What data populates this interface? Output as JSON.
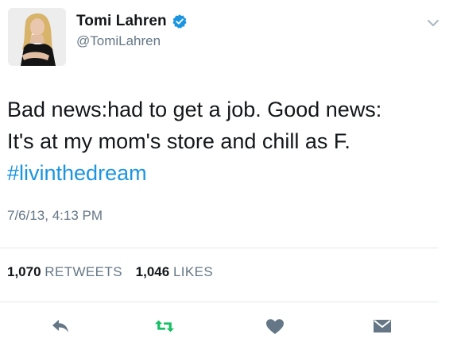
{
  "author": {
    "display_name": "Tomi Lahren",
    "handle": "@TomiLahren",
    "avatar_icon": "profile-photo",
    "verified_icon": "verified-badge-icon"
  },
  "tweet": {
    "line1": "Bad news:had to get a job. Good news:",
    "line2": "It's at my mom's store and chill as F.",
    "hashtag": "#livinthedream",
    "timestamp": "7/6/13, 4:13 PM"
  },
  "stats": {
    "retweets_count": "1,070",
    "retweets_label": "RETWEETS",
    "likes_count": "1,046",
    "likes_label": "LIKES"
  },
  "actions": {
    "reply_icon": "reply-icon",
    "retweet_icon": "retweet-icon",
    "like_icon": "heart-icon",
    "dm_icon": "envelope-icon"
  },
  "colors": {
    "link": "#1b95e0",
    "retweet_green": "#17bf63",
    "icon_gray": "#657786",
    "text": "#14171a",
    "divider": "#e1e8ed"
  }
}
